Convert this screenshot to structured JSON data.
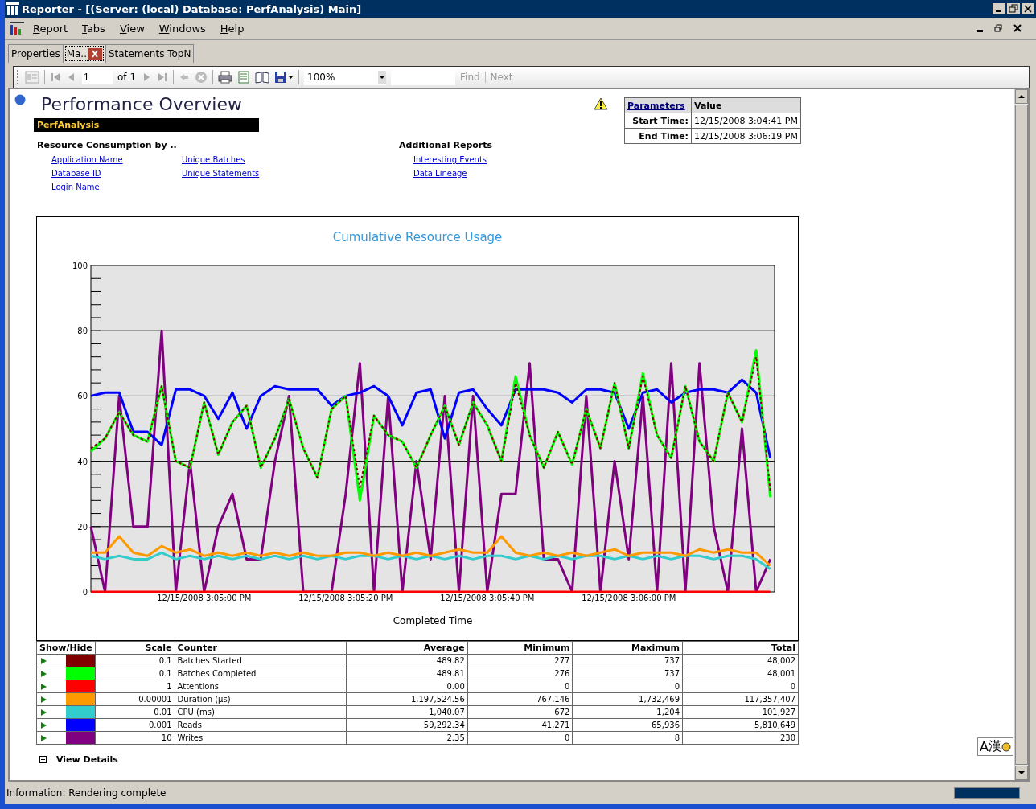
{
  "window": {
    "title": "Reporter - [(Server: (local) Database: PerfAnalysis) Main]"
  },
  "menu": [
    "Report",
    "Tabs",
    "View",
    "Windows",
    "Help"
  ],
  "tabs": [
    {
      "label": "Properties",
      "selected": false,
      "closable": false
    },
    {
      "label": "Ma..",
      "selected": true,
      "closable": true
    },
    {
      "label": "Statements TopN",
      "selected": false,
      "closable": false
    }
  ],
  "toolbar": {
    "page": "1",
    "page_count": "of 1",
    "zoom": "100%",
    "find": "Find",
    "next": "Next"
  },
  "report": {
    "title": "Performance Overview",
    "database": "PerfAnalysis",
    "sections": [
      {
        "heading": "Resource Consumption by ..",
        "columns": [
          [
            "Application Name",
            "Database ID",
            "Login Name"
          ],
          [
            "Unique Batches",
            "Unique Statements"
          ]
        ]
      },
      {
        "heading": "Additional Reports",
        "columns": [
          [
            "Interesting Events",
            "Data Lineage"
          ]
        ]
      }
    ],
    "parameters": {
      "columns": [
        "Parameters",
        "Value"
      ],
      "rows": [
        [
          "Start Time:",
          "12/15/2008 3:04:41 PM"
        ],
        [
          "End Time:",
          "12/15/2008 3:06:19 PM"
        ]
      ]
    },
    "chart_data": {
      "type": "line",
      "title": "Cumulative Resource Usage",
      "xlabel": "Completed Time",
      "categories": [
        null,
        null,
        null,
        null,
        null,
        null,
        null,
        null,
        "12/15/2008 3:05:00 PM",
        null,
        null,
        null,
        null,
        null,
        null,
        null,
        null,
        null,
        "12/15/2008 3:05:20 PM",
        null,
        null,
        null,
        null,
        null,
        null,
        null,
        null,
        null,
        "12/15/2008 3:05:40 PM",
        null,
        null,
        null,
        null,
        null,
        null,
        null,
        null,
        null,
        "12/15/2008 3:06:00 PM",
        null,
        null,
        null,
        null,
        null,
        null,
        null,
        null,
        null,
        null
      ],
      "ylim": [
        0,
        100
      ],
      "yticks": [
        0,
        20,
        40,
        60,
        80,
        100
      ],
      "grid": true,
      "series": [
        {
          "color": "#800000",
          "line_style": "dotted",
          "values": [
            44,
            47,
            55,
            48,
            46,
            63,
            40,
            38,
            58,
            42,
            52,
            57,
            38,
            47,
            59,
            44,
            35,
            56,
            60,
            32,
            54,
            48,
            46,
            38,
            48,
            57,
            45,
            58,
            51,
            40,
            64,
            48,
            38,
            49,
            39,
            56,
            44,
            64,
            44,
            66,
            48,
            41,
            63,
            46,
            40,
            61,
            52,
            72,
            31
          ]
        },
        {
          "color": "#00ff00",
          "line_style": "solid",
          "values": [
            43,
            47,
            55,
            48,
            46,
            63,
            40,
            38,
            58,
            42,
            52,
            57,
            38,
            47,
            59,
            44,
            35,
            56,
            60,
            28,
            54,
            48,
            46,
            38,
            48,
            57,
            45,
            58,
            51,
            40,
            66,
            48,
            38,
            49,
            39,
            56,
            44,
            64,
            44,
            67,
            48,
            41,
            63,
            46,
            40,
            61,
            52,
            74,
            29
          ]
        },
        {
          "color": "#ff0000",
          "line_style": "solid",
          "values": [
            0,
            0,
            0,
            0,
            0,
            0,
            0,
            0,
            0,
            0,
            0,
            0,
            0,
            0,
            0,
            0,
            0,
            0,
            0,
            0,
            0,
            0,
            0,
            0,
            0,
            0,
            0,
            0,
            0,
            0,
            0,
            0,
            0,
            0,
            0,
            0,
            0,
            0,
            0,
            0,
            0,
            0,
            0,
            0,
            0,
            0,
            0,
            0,
            0
          ]
        },
        {
          "color": "#ff9900",
          "line_style": "solid",
          "values": [
            12,
            12,
            17,
            12,
            11,
            14,
            12,
            13,
            11,
            12,
            11,
            12,
            11,
            12,
            11,
            12,
            11,
            11,
            12,
            12,
            11,
            12,
            11,
            12,
            11,
            12,
            13,
            12,
            12,
            17,
            12,
            11,
            12,
            11,
            12,
            11,
            12,
            13,
            11,
            12,
            12,
            12,
            11,
            13,
            12,
            13,
            12,
            12,
            8
          ]
        },
        {
          "color": "#33cccc",
          "line_style": "solid",
          "values": [
            11,
            10,
            11,
            10,
            10,
            12,
            10,
            11,
            10,
            11,
            10,
            11,
            10,
            11,
            10,
            11,
            10,
            11,
            10,
            11,
            11,
            10,
            11,
            10,
            11,
            10,
            11,
            10,
            11,
            11,
            10,
            11,
            10,
            11,
            10,
            11,
            11,
            10,
            11,
            10,
            11,
            10,
            11,
            11,
            10,
            11,
            11,
            10,
            7
          ]
        },
        {
          "color": "#0000ff",
          "line_style": "solid",
          "values": [
            60,
            61,
            61,
            49,
            49,
            45,
            62,
            62,
            60,
            53,
            61,
            50,
            60,
            63,
            62,
            62,
            62,
            57,
            60,
            61,
            63,
            60,
            51,
            61,
            62,
            47,
            61,
            62,
            56,
            51,
            62,
            62,
            62,
            61,
            58,
            62,
            62,
            61,
            50,
            61,
            62,
            58,
            61,
            62,
            62,
            61,
            65,
            61,
            41
          ]
        },
        {
          "color": "#800080",
          "line_style": "solid",
          "values": [
            20,
            0,
            60,
            20,
            20,
            80,
            0,
            40,
            0,
            20,
            30,
            10,
            10,
            40,
            60,
            0,
            0,
            0,
            30,
            70,
            0,
            60,
            0,
            40,
            10,
            60,
            0,
            60,
            0,
            30,
            30,
            70,
            10,
            10,
            0,
            60,
            0,
            40,
            10,
            60,
            0,
            70,
            0,
            70,
            20,
            0,
            50,
            0,
            10
          ]
        }
      ]
    },
    "legend": {
      "columns": [
        "Show/Hide",
        "Scale",
        "Counter",
        "Average",
        "Minimum",
        "Maximum",
        "Total"
      ],
      "rows": [
        {
          "color": "#800000",
          "cells": [
            "",
            "0.1",
            "Batches Started",
            "489.82",
            "277",
            "737",
            "48,002"
          ]
        },
        {
          "color": "#00ff00",
          "cells": [
            "",
            "0.1",
            "Batches Completed",
            "489.81",
            "276",
            "737",
            "48,001"
          ]
        },
        {
          "color": "#ff0000",
          "cells": [
            "",
            "1",
            "Attentions",
            "0.00",
            "0",
            "0",
            "0"
          ]
        },
        {
          "color": "#ff9900",
          "cells": [
            "",
            "0.00001",
            "Duration (µs)",
            "1,197,524.56",
            "767,146",
            "1,732,469",
            "117,357,407"
          ]
        },
        {
          "color": "#33cccc",
          "cells": [
            "",
            "0.01",
            "CPU (ms)",
            "1,040.07",
            "672",
            "1,204",
            "101,927"
          ]
        },
        {
          "color": "#0000ff",
          "cells": [
            "",
            "0.001",
            "Reads",
            "59,292.34",
            "41,271",
            "65,936",
            "5,810,649"
          ]
        },
        {
          "color": "#800080",
          "cells": [
            "",
            "10",
            "Writes",
            "2.35",
            "0",
            "8",
            "230"
          ]
        }
      ]
    },
    "details": {
      "label": "View Details",
      "expanded": false
    }
  },
  "ime": {
    "mode": "A",
    "hanja": "漢"
  },
  "status_bar": {
    "text": "Information: Rendering complete",
    "level": 1
  }
}
